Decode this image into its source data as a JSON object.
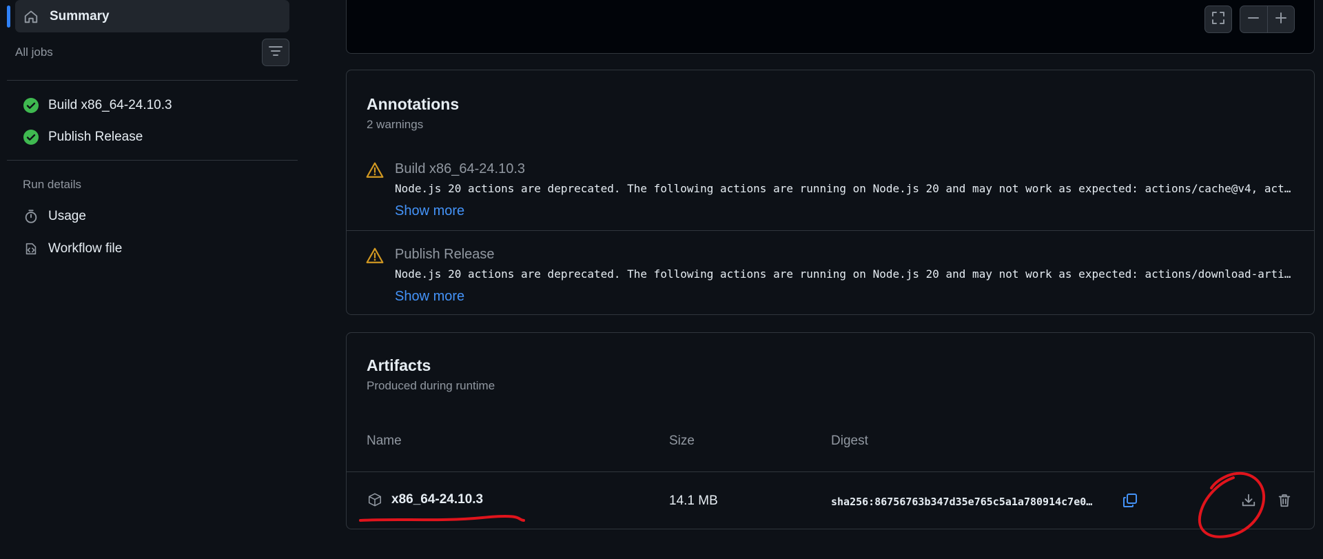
{
  "sidebar": {
    "summary_label": "Summary",
    "all_jobs_label": "All jobs",
    "jobs": [
      {
        "label": "Build x86_64-24.10.3",
        "status": "success"
      },
      {
        "label": "Publish Release",
        "status": "success"
      }
    ],
    "run_details_label": "Run details",
    "details": [
      {
        "label": "Usage",
        "icon": "stopwatch-icon"
      },
      {
        "label": "Workflow file",
        "icon": "file-code-icon"
      }
    ]
  },
  "annotations": {
    "title": "Annotations",
    "subtitle": "2 warnings",
    "items": [
      {
        "title": "Build x86_64-24.10.3",
        "message": "Node.js 20 actions are deprecated. The following actions are running on Node.js 20 and may not work as expected: actions/cache@v4, act…",
        "show_more": "Show more"
      },
      {
        "title": "Publish Release",
        "message": "Node.js 20 actions are deprecated. The following actions are running on Node.js 20 and may not work as expected: actions/download-arti…",
        "show_more": "Show more"
      }
    ]
  },
  "artifacts": {
    "title": "Artifacts",
    "subtitle": "Produced during runtime",
    "columns": {
      "name": "Name",
      "size": "Size",
      "digest": "Digest"
    },
    "rows": [
      {
        "name": "x86_64-24.10.3",
        "size": "14.1 MB",
        "digest": "sha256:86756763b347d35e765c5a1a780914c7e0…"
      }
    ]
  },
  "colors": {
    "background": "#0d1117",
    "success": "#3fb950",
    "warning": "#d29922",
    "link": "#4493f8",
    "accent": "#2f81f7",
    "markup": "#e0141c"
  }
}
